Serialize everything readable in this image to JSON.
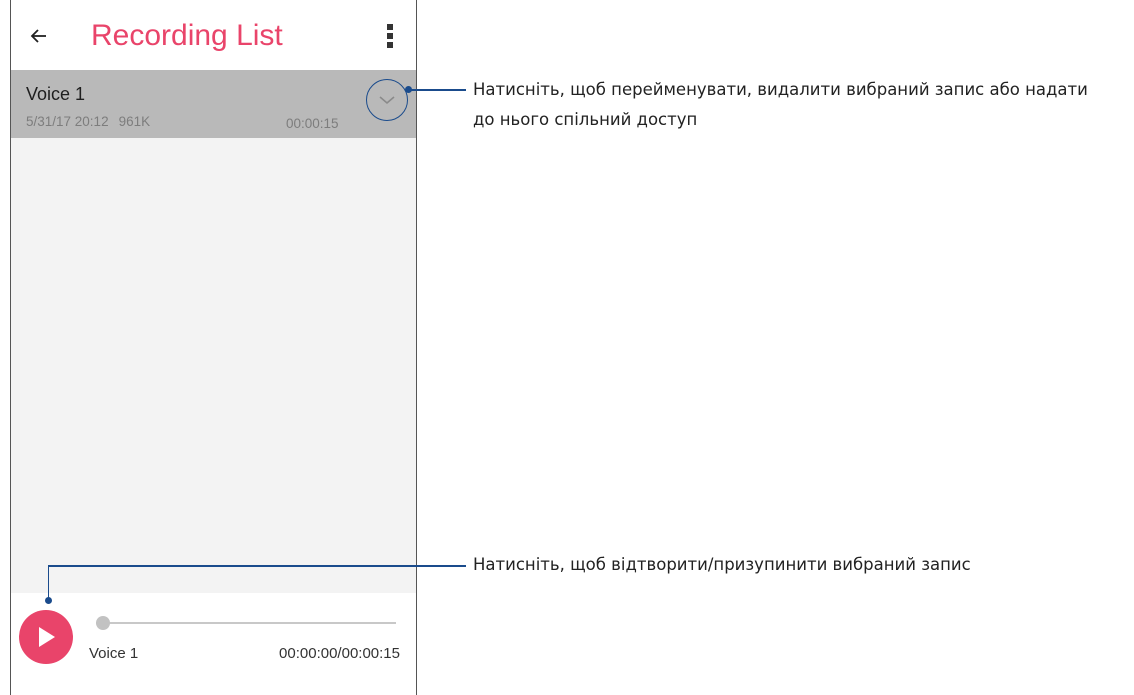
{
  "app_bar": {
    "back_icon": "arrow-left-icon",
    "title": "Recording List",
    "menu_icon": "more-vert-icon",
    "title_color": "#e9446a"
  },
  "recordings": [
    {
      "name": "Voice 1",
      "date": "5/31/17 20:12",
      "size": "961K",
      "duration": "00:00:15",
      "expand_icon": "chevron-down-icon",
      "selected": true
    }
  ],
  "player": {
    "play_icon": "play-icon",
    "track_name": "Voice 1",
    "time": "00:00:00/00:00:15",
    "progress": 0.0,
    "accent": "#e9446a"
  },
  "callouts": {
    "expand": "Натисніть, щоб перейменувати, видалити вибраний запис або надати до нього спільний доступ",
    "expand_line1": "Натисніть, щоб перейменувати, видалити вибраний запис або надати",
    "expand_line2": "до нього спільний доступ",
    "play": "Натисніть, щоб відтворити/призупинити вибраний запис",
    "line_color": "#1a4b8c"
  }
}
